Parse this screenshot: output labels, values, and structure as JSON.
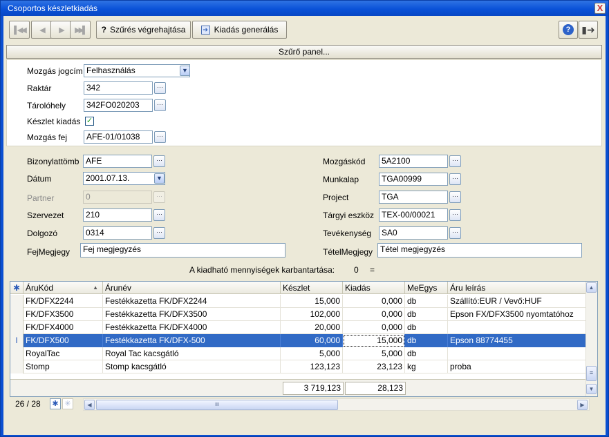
{
  "window": {
    "title": "Csoportos készletkiadás",
    "close_glyph": "X"
  },
  "toolbar": {
    "first_icon": "first-record-icon",
    "prev_icon": "prev-record-icon",
    "next_icon": "next-record-icon",
    "last_icon": "last-record-icon",
    "filter_glyph": "?",
    "filter_label": "Szűrés végrehajtása",
    "generate_label": "Kiadás generálás",
    "help_glyph": "?",
    "exit_icon": "exit-icon"
  },
  "filter_panel": {
    "toggle_label": "Szűrő panel...",
    "movement_title_label": "Mozgás jogcím",
    "movement_title_value": "Felhasználás",
    "warehouse_label": "Raktár",
    "warehouse_value": "342",
    "location_label": "Tárolóhely",
    "location_value": "342FO020203",
    "stock_issue_label": "Készlet kiadás",
    "stock_issue_checked": "✓",
    "movement_head_label": "Mozgás fej",
    "movement_head_value": "AFE-01/01038"
  },
  "header": {
    "voucher_block_label": "Bizonylattömb",
    "voucher_block_value": "AFE",
    "date_label": "Dátum",
    "date_value": "2001.07.13.",
    "partner_label": "Partner",
    "partner_value": "0",
    "organization_label": "Szervezet",
    "organization_value": "210",
    "employee_label": "Dolgozó",
    "employee_value": "0314",
    "head_note_label": "FejMegjegy",
    "head_note_value": "Fej megjegyzés",
    "movement_code_label": "Mozgáskód",
    "movement_code_value": "5A2100",
    "worksheet_label": "Munkalap",
    "worksheet_value": "TGA00999",
    "project_label": "Project",
    "project_value": "TGA",
    "asset_label": "Tárgyi eszköz",
    "asset_value": "TEX-00/00021",
    "activity_label": "Tevékenység",
    "activity_value": "SA0",
    "item_note_label": "TételMegjegy",
    "item_note_value": "Tétel megjegyzés",
    "dots_glyph": "···"
  },
  "maintenance": {
    "label": "A kiadható mennyiségek karbantartása:",
    "count": "0",
    "eq": "="
  },
  "grid": {
    "corner_icon": "✱",
    "columns": [
      "ÁruKód",
      "Árunév",
      "Készlet",
      "Kiadás",
      "MeEgys",
      "Áru leírás"
    ],
    "sort_glyph": "▲",
    "rows": [
      {
        "code": "FK/DFX2244",
        "name": "Festékkazetta FK/DFX2244",
        "stock": "15,000",
        "issue": "0,000",
        "unit": "db",
        "desc": "Szállító:EUR / Vevő:HUF",
        "ind": ""
      },
      {
        "code": "FK/DFX3500",
        "name": "Festékkazetta FK/DFX3500",
        "stock": "102,000",
        "issue": "0,000",
        "unit": "db",
        "desc": "Epson FX/DFX3500 nyomtatóhoz",
        "ind": ""
      },
      {
        "code": "FK/DFX4000",
        "name": "Festékkazetta FK/DFX4000",
        "stock": "20,000",
        "issue": "0,000",
        "unit": "db",
        "desc": "",
        "ind": ""
      },
      {
        "code": "FK/DFX500",
        "name": "Festékkazetta FK/DFX-500",
        "stock": "60,000",
        "issue": "15,000",
        "unit": "db",
        "desc": "Epson 88774455",
        "ind": "I"
      },
      {
        "code": "RoyalTac",
        "name": "Royal Tac kacsgátló",
        "stock": "5,000",
        "issue": "5,000",
        "unit": "db",
        "desc": "",
        "ind": ""
      },
      {
        "code": "Stomp",
        "name": "Stomp kacsgátló",
        "stock": "123,123",
        "issue": "23,123",
        "unit": "kg",
        "desc": "proba",
        "ind": ""
      }
    ],
    "total_stock": "3 719,123",
    "total_issue": "28,123"
  },
  "status": {
    "record_position": "26 / 28",
    "new_icon": "✱",
    "new2_icon": "✳",
    "hscroll_thumb": "III"
  },
  "colors": {
    "title_blue": "#0a52d8",
    "selection": "#316ac5",
    "client_bg": "#ece9d8"
  }
}
